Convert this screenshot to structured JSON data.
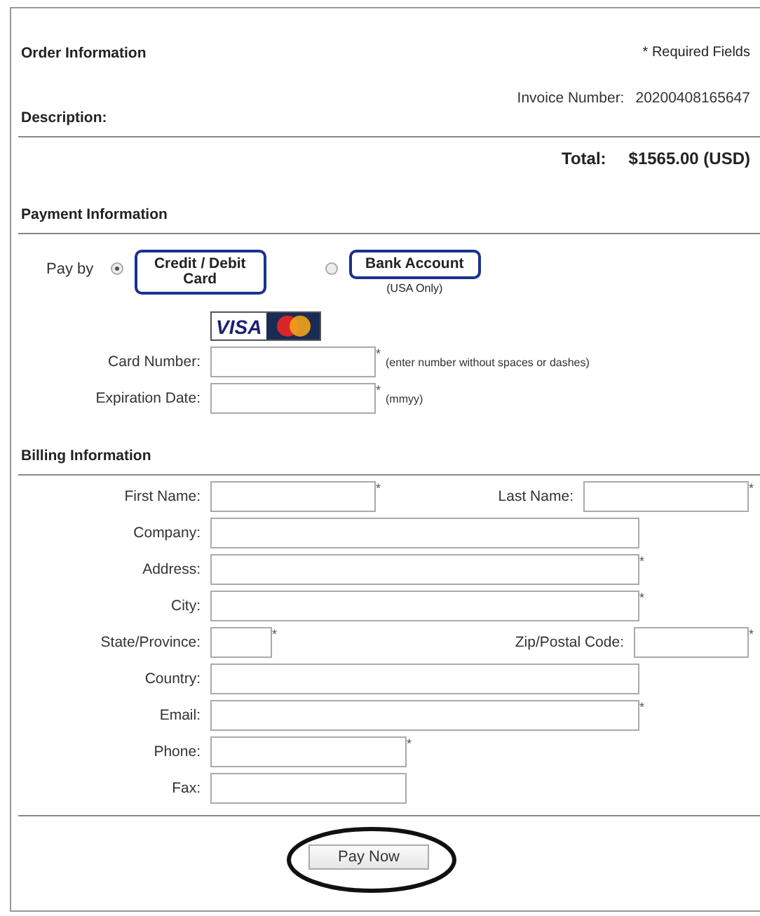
{
  "order": {
    "title": "Order Information",
    "required_note": "* Required Fields",
    "invoice_label": "Invoice Number:",
    "invoice_number": "20200408165647",
    "description_label": "Description:",
    "total_label": "Total:",
    "total_value": "$1565.00 (USD)"
  },
  "payment": {
    "title": "Payment Information",
    "pay_by_label": "Pay by",
    "methods": [
      {
        "label": "Credit / Debit Card",
        "selected": true
      },
      {
        "label": "Bank Account",
        "note": "(USA Only)",
        "selected": false
      }
    ],
    "card_logo": "VISA",
    "fields": [
      {
        "label": "Card Number:",
        "mark": "*",
        "hint": "(enter number without spaces or dashes)",
        "kind": "medium"
      },
      {
        "label": "Expiration Date:",
        "mark": "*",
        "hint": "(mmyy)",
        "kind": "medium"
      }
    ]
  },
  "billing": {
    "title": "Billing Information",
    "rows": [
      [
        {
          "label": "First Name:",
          "mark": "*",
          "kind": "medium"
        },
        {
          "label": "Last Name:",
          "mark": "*",
          "kind": "medium"
        }
      ],
      [
        {
          "label": "Company:",
          "kind": "wide"
        }
      ],
      [
        {
          "label": "Address:",
          "mark": "*",
          "kind": "wide"
        }
      ],
      [
        {
          "label": "City:",
          "mark": "*",
          "kind": "wide"
        }
      ],
      [
        {
          "label": "State/Province:",
          "mark": "*",
          "kind": "tiny"
        },
        {
          "label": "Zip/Postal Code:",
          "mark": "*",
          "kind": "short"
        }
      ],
      [
        {
          "label": "Country:",
          "kind": "wide"
        }
      ],
      [
        {
          "label": "Email:",
          "mark": "*",
          "kind": "wide"
        }
      ],
      [
        {
          "label": "Phone:",
          "mark": "*",
          "kind": "half"
        }
      ],
      [
        {
          "label": "Fax:",
          "kind": "half"
        }
      ]
    ]
  },
  "submit": {
    "label": "Pay Now",
    "circled": true
  }
}
